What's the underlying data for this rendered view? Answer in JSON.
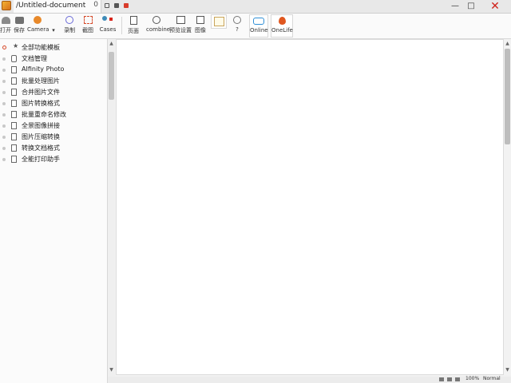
{
  "titlebar": {
    "tab_title": "/Untitled-document",
    "tab_close": "0",
    "close_glyph": "✕"
  },
  "toolbar": {
    "tools": [
      {
        "name": "open",
        "label": "打开"
      },
      {
        "name": "save",
        "label": "保存"
      },
      {
        "name": "camera",
        "label": "Camera"
      },
      {
        "name": "dropdown",
        "label": "▾"
      },
      {
        "name": "record",
        "label": "录制"
      },
      {
        "name": "capture",
        "label": "截图"
      },
      {
        "name": "cases",
        "label": "Cases"
      },
      {
        "name": "page",
        "label": "页面"
      },
      {
        "name": "combine",
        "label": "combine"
      },
      {
        "name": "preview",
        "label": "预览设置"
      },
      {
        "name": "image",
        "label": "图像"
      },
      {
        "name": "help",
        "label": "?"
      },
      {
        "name": "online",
        "label": "Online"
      },
      {
        "name": "onelife",
        "label": "OneLife"
      }
    ]
  },
  "sidebar": {
    "items": [
      {
        "label": "全部功能模板"
      },
      {
        "label": "文档管理"
      },
      {
        "label": "AIfinity Photo"
      },
      {
        "label": "批量处理图片"
      },
      {
        "label": "合并图片文件"
      },
      {
        "label": "图片转换格式"
      },
      {
        "label": "批量重命名修改"
      },
      {
        "label": "全景图像拼接"
      },
      {
        "label": "图片压缩转换"
      },
      {
        "label": "转换文档格式"
      },
      {
        "label": "全能打印助手"
      }
    ]
  },
  "statusbar": {
    "zoom": "100%",
    "mode": "Normal"
  },
  "colors": {
    "accent": "#d64a2a",
    "online": "#2f8fd6",
    "app_icon": "#f2b233"
  }
}
